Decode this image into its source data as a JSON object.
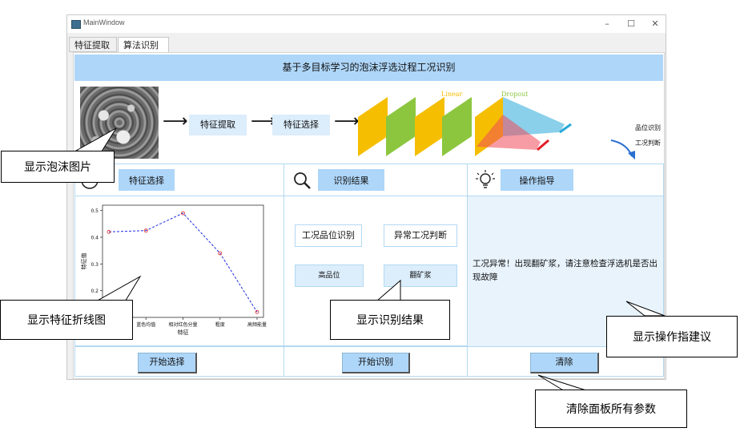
{
  "window": {
    "title": "MainWindow",
    "controls": [
      "–",
      "☐",
      "✕"
    ]
  },
  "tabs": [
    {
      "label": "特征提取"
    },
    {
      "label": "算法识别"
    }
  ],
  "header": {
    "title": "基于多目标学习的泡沫浮选过程工况识别"
  },
  "pipeline": {
    "steps": [
      "特征提取",
      "特征选择"
    ],
    "layer_labels": {
      "linear": "Linear",
      "dropout": "Dropout"
    },
    "outputs": [
      "品位识别",
      "工况判断"
    ],
    "colors": {
      "linear": "#f5be00",
      "dropout": "#8cc63f",
      "red_head": "#f04a5a",
      "cyan_head": "#2aa9d8"
    }
  },
  "panels": {
    "feature": {
      "button": "特征选择",
      "icon": "chart-circle-icon"
    },
    "result": {
      "button": "识别结果",
      "icon": "magnifier-icon",
      "labels": [
        "工况品位识别",
        "异常工况判断"
      ],
      "values": [
        "高品位",
        "翻矿浆"
      ]
    },
    "guide": {
      "button": "操作指导",
      "icon": "lightbulb-icon",
      "advice": "工况异常！出现翻矿浆，请注意检查浮选机是否出现故障"
    }
  },
  "bottom_buttons": {
    "start_select": "开始选择",
    "start_identify": "开始识别",
    "clear": "清除"
  },
  "chart_data": {
    "type": "line",
    "categories": [
      "蓝色均值",
      "相对红色分量",
      "粗度",
      "高频能量"
    ],
    "visible_tick_labels": [
      "蓝色均值",
      "相对红色分量",
      "粗度",
      "高频能量"
    ],
    "x_tick_labels": [
      "蓝色均值",
      "相对红色分量",
      "粗度",
      "高频能量"
    ],
    "x_points": [
      0,
      1,
      2,
      3,
      4,
      5
    ],
    "values": [
      0.42,
      0.425,
      0.49,
      0.34,
      0.12
    ],
    "xlabel": "特征",
    "ylabel": "特征值",
    "yticks": [
      "0.5",
      "0.4",
      "0.3",
      "0.2"
    ],
    "ylim": [
      0.1,
      0.52
    ],
    "line_color": "#1f2ee0",
    "marker_color": "#e02020"
  },
  "callouts": {
    "foam_image": "显示泡沫图片",
    "feature_chart": "显示特征折线图",
    "result_display": "显示识别结果",
    "advice_display": "显示操作指建议",
    "clear_all": "清除面板所有参数"
  }
}
